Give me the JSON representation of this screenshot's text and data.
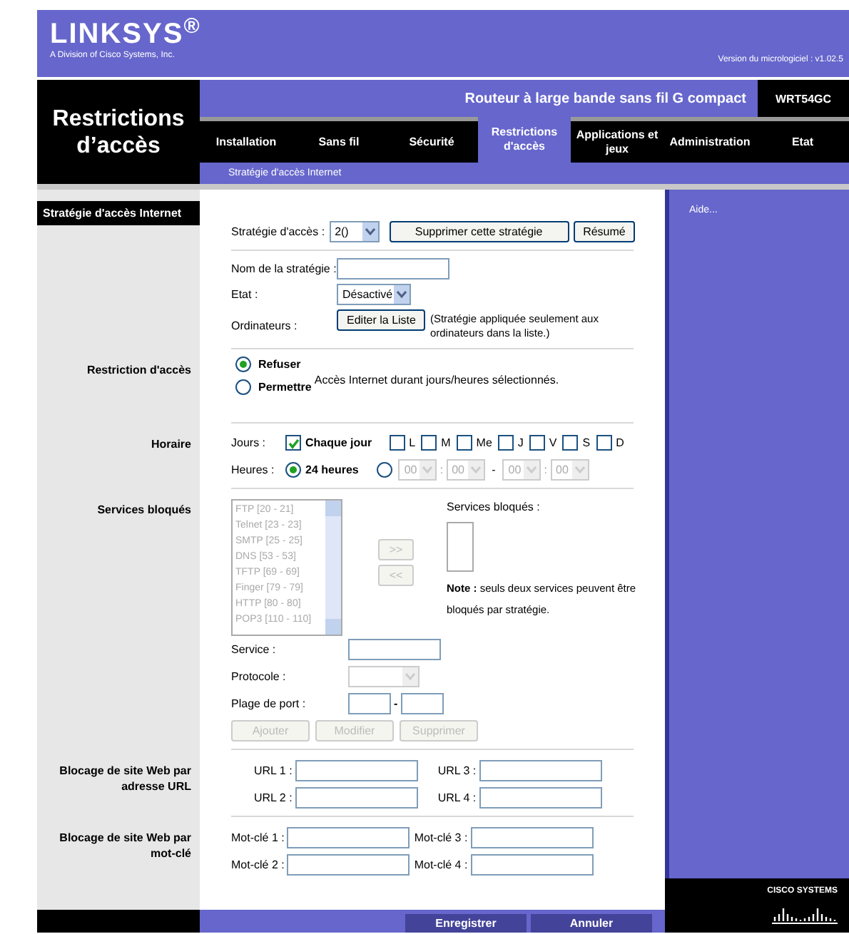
{
  "header": {
    "logo": "LINKSYS$^{®}$",
    "logo_subtitle": "A Division of Cisco Systems, Inc.",
    "firmware": "Version du micrologiciel : v1.02.5"
  },
  "page_title": "Restrictions d’accès",
  "product": "Routeur à large bande sans fil G compact",
  "model": "WRT54GC",
  "tabs": [
    {
      "label": "Installation",
      "selected": false
    },
    {
      "label": "Sans fil",
      "selected": false
    },
    {
      "label": "Sécurité",
      "selected": false
    },
    {
      "label": "Restrictions d'accès",
      "selected": true
    },
    {
      "label": "Applications et jeux",
      "selected": false
    },
    {
      "label": "Administration",
      "selected": false
    },
    {
      "label": "Etat",
      "selected": false
    }
  ],
  "subnav": "Stratégie d'accès Internet",
  "section_title": "Stratégie d'accès Internet",
  "help": "Aide...",
  "policy": {
    "label": "Stratégie d'accès :",
    "value": "2()",
    "delete_button": "Supprimer cette stratégie",
    "summary_button": "Résumé"
  },
  "policy_name": {
    "label": "Nom de la stratégie :"
  },
  "state": {
    "label": "Etat :",
    "value": "Désactivé"
  },
  "computers": {
    "label": "Ordinateurs :",
    "button": "Editer la Liste",
    "note": "(Stratégie appliquée seulement aux ordinateurs dans la liste.)"
  },
  "restriction": {
    "title": "Restriction d'accès",
    "options": [
      {
        "label": "Refuser",
        "selected": true
      },
      {
        "label": "Permettre",
        "selected": false
      }
    ],
    "description": "Accès Internet durant jours/heures sélectionnés."
  },
  "schedule": {
    "title": "Horaire",
    "days_label": "Jours :",
    "days": [
      {
        "label": "Chaque jour",
        "checked": true
      },
      {
        "label": "L",
        "checked": false
      },
      {
        "label": "M",
        "checked": false
      },
      {
        "label": "Me",
        "checked": false
      },
      {
        "label": "J",
        "checked": false
      },
      {
        "label": "V",
        "checked": false
      },
      {
        "label": "S",
        "checked": false
      },
      {
        "label": "D",
        "checked": false
      }
    ],
    "hours_label": "Heures :",
    "all_day": {
      "label": "24 heures",
      "selected": true
    },
    "custom": {
      "selected": false,
      "disabled": true,
      "from_hour": "00",
      "from_sep": ":",
      "from_minute": "00",
      "dash": "-",
      "to_hour": "00",
      "to_sep": ":",
      "to_minute": "00"
    }
  },
  "services": {
    "title": "Services bloqués",
    "disabled": true,
    "available": [
      "FTP [20 - 21]",
      "Telnet [23 - 23]",
      "SMTP [25 - 25]",
      "DNS [53 - 53]",
      "TFTP [69 - 69]",
      "Finger [79 - 79]",
      "HTTP [80 - 80]",
      "POP3 [110 - 110]"
    ],
    "add_button": ">>",
    "remove_button": "<<",
    "blocked_label": "Services bloqués :",
    "note": "**Note :** seuls deux services peuvent être bloqués par stratégie.",
    "service_label": "Service :",
    "protocol_label": "Protocole :",
    "port_label": "Plage de port :",
    "port_separator": "-",
    "buttons": [
      "Ajouter",
      "Modifier",
      "Supprimer"
    ]
  },
  "url_blocking": {
    "title": "Blocage de site Web par adresse URL",
    "fields": [
      "URL 1 :",
      "URL 2 :",
      "URL 3 :",
      "URL 4 :"
    ]
  },
  "keyword_blocking": {
    "title": "Blocage de site Web par mot-clé",
    "fields": [
      "Mot-clé 1 :",
      "Mot-clé 2 :",
      "Mot-clé 3 :",
      "Mot-clé 4 :"
    ]
  },
  "footer": {
    "buttons": [
      "Enregistrer",
      "Annuler"
    ]
  },
  "cisco_logo": "CISCO SYSTEMS"
}
